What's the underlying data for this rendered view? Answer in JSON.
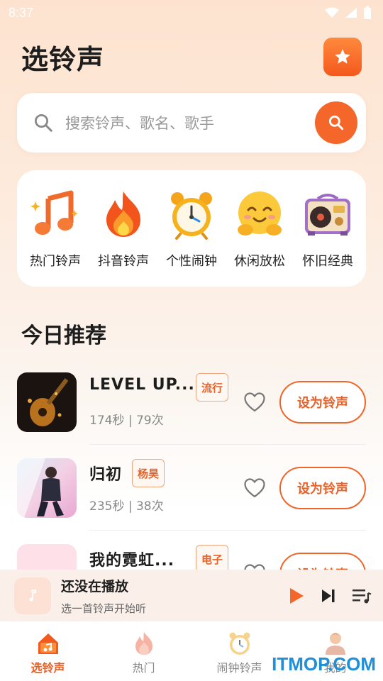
{
  "status_bar": {
    "time": "8:37"
  },
  "header": {
    "title": "选铃声",
    "star_icon": "star-icon"
  },
  "search": {
    "placeholder": "搜索铃声、歌名、歌手"
  },
  "categories": [
    {
      "label": "热门铃声",
      "icon": "music-note-icon"
    },
    {
      "label": "抖音铃声",
      "icon": "fire-icon"
    },
    {
      "label": "个性闹钟",
      "icon": "alarm-clock-icon"
    },
    {
      "label": "休闲放松",
      "icon": "smiley-hug-icon"
    },
    {
      "label": "怀旧经典",
      "icon": "radio-icon"
    }
  ],
  "section": {
    "title": "今日推荐"
  },
  "songs": [
    {
      "title": "LEVEL UP...",
      "tag": "流行",
      "meta": "174秒 | 79次",
      "button": "设为铃声"
    },
    {
      "title": "归初",
      "tag": "杨昊",
      "meta": "235秒 | 38次",
      "button": "设为铃声"
    },
    {
      "title": "我的霓虹...",
      "tag": "电子",
      "meta": "",
      "button": "设为铃声"
    }
  ],
  "player": {
    "title": "还没在播放",
    "subtitle": "选一首铃声开始听"
  },
  "nav": [
    {
      "label": "选铃声",
      "active": true
    },
    {
      "label": "热门",
      "active": false
    },
    {
      "label": "闹钟铃声",
      "active": false
    },
    {
      "label": "我的",
      "active": false
    }
  ],
  "watermark": "ITMOP.COM",
  "colors": {
    "accent": "#f4662a",
    "tag_border": "#f0a67c"
  }
}
